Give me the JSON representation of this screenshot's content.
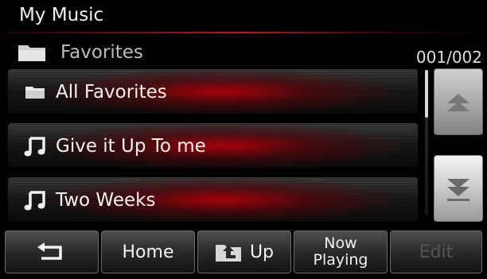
{
  "header": {
    "title": "My Music"
  },
  "breadcrumb": {
    "label": "Favorites",
    "icon": "folder-icon"
  },
  "pager": {
    "text": "001/002"
  },
  "list": {
    "items": [
      {
        "label": "All Favorites",
        "icon": "folder-icon"
      },
      {
        "label": "Give it Up To me",
        "icon": "music-note-icon"
      },
      {
        "label": "Two Weeks",
        "icon": "music-note-icon"
      }
    ]
  },
  "scroll": {
    "up_icon": "scroll-up-icon",
    "down_icon": "scroll-down-icon",
    "position_fraction": 0.0
  },
  "toolbar": {
    "back_icon": "back-arrow-icon",
    "home_label": "Home",
    "up_label": "Up",
    "now_playing_line1": "Now",
    "now_playing_line2": "Playing",
    "edit_label": "Edit"
  },
  "colors": {
    "accent": "#c0181c",
    "background": "#000000"
  }
}
